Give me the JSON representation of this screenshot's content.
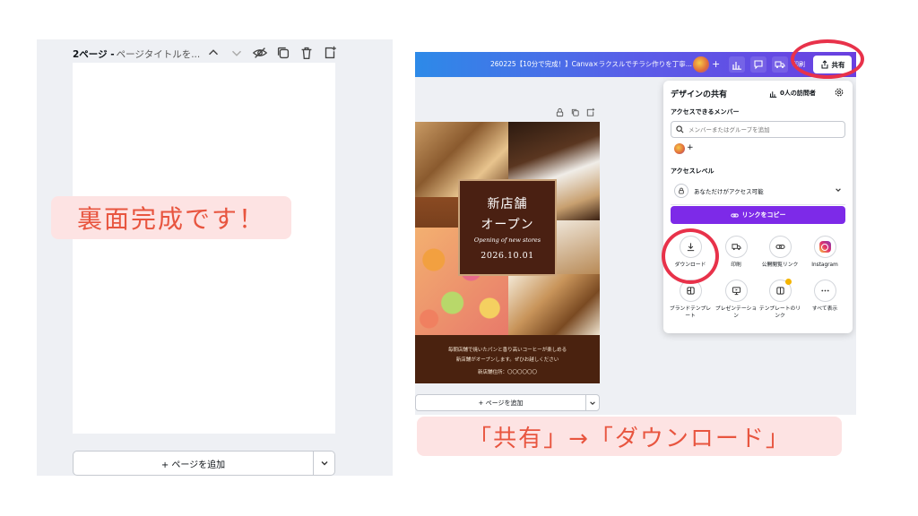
{
  "left": {
    "page_label": "2ページ -",
    "page_title_placeholder": "ページタイトルを...",
    "note": "裏面完成です！",
    "add_page": "+ ページを追加"
  },
  "right": {
    "doc_title": "260225【10分で完成！】Canva×ラクスルでチラシ作りを丁寧...",
    "print_label": "印刷",
    "share_label": "共有",
    "flyer": {
      "heading1": "新店舗",
      "heading2": "オープン",
      "script": "Opening of new stores",
      "date": "2026.10.01",
      "body1": "毎朝店舗で焼いたパンと香り高いコーヒーが楽しめる",
      "body2": "新店舗がオープンします。ぜひお越しください",
      "address": "新店舗住所：〇〇〇〇〇〇"
    },
    "add_page": "+ ページを追加",
    "share_panel": {
      "title": "デザインの共有",
      "visitors": "0人の訪問者",
      "members_label": "アクセスできるメンバー",
      "search_placeholder": "メンバーまたはグループを追加",
      "access_level_label": "アクセスレベル",
      "access_value": "あなただけがアクセス可能",
      "copy_link": "リンクをコピー",
      "options": [
        {
          "label": "ダウンロード",
          "icon": "download-icon"
        },
        {
          "label": "印刷",
          "icon": "truck-icon"
        },
        {
          "label": "公開閲覧リンク",
          "icon": "link-icon"
        },
        {
          "label": "Instagram",
          "icon": "instagram-icon"
        },
        {
          "label": "ブランドテンプレート",
          "icon": "brand-template-icon"
        },
        {
          "label": "プレゼンテーション",
          "icon": "presentation-icon"
        },
        {
          "label": "テンプレートのリンク",
          "icon": "template-link-icon"
        },
        {
          "label": "すべて表示",
          "icon": "more-icon"
        }
      ]
    }
  },
  "caption": "「共有」→「ダウンロード」",
  "colors": {
    "accent": "#7d2ae8",
    "highlight": "#e8324a",
    "note_bg": "#fde3e3",
    "note_text": "#e8553f"
  }
}
